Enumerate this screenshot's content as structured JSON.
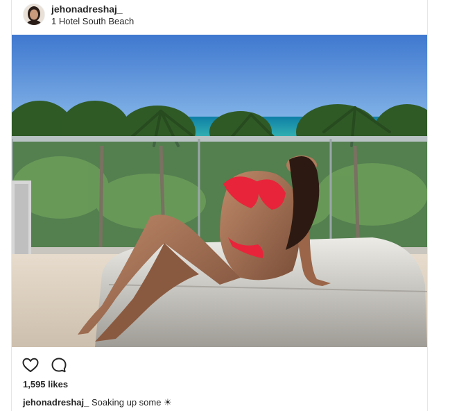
{
  "post": {
    "username": "jehonadreshaj_",
    "location": "1 Hotel South Beach",
    "avatar_icon": "profile-avatar",
    "photo_description_icon": "post-photo",
    "actions": {
      "like_icon": "heart-icon",
      "comment_icon": "comment-bubble-icon"
    },
    "likes": "1,595 likes",
    "caption": {
      "username": "jehonadreshaj_",
      "text": "Soaking up some ☀"
    }
  },
  "colors": {
    "text": "#262626",
    "border": "#e6e6e6",
    "sky": "#4f86d4",
    "sea": "#1fa0a6",
    "bikini": "#e8243a",
    "lounger": "#d8d4cc"
  }
}
